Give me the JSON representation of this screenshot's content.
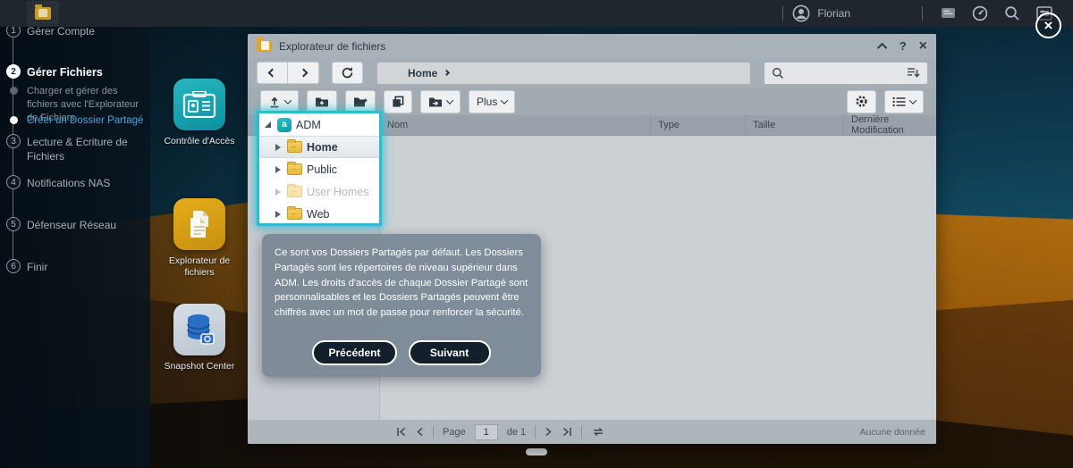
{
  "topbar": {
    "user_name": "Florian",
    "icons": [
      "chat-icon",
      "gauge-icon",
      "search-icon",
      "preferences-icon"
    ]
  },
  "overlay": {
    "close_glyph": "×"
  },
  "sidebar": {
    "steps": [
      {
        "kind": "step",
        "num": "1",
        "label": "Gérer Compte",
        "state": ""
      },
      {
        "kind": "step",
        "num": "2",
        "label": "Gérer Fichiers",
        "state": "active"
      },
      {
        "kind": "sub",
        "label": "Charger et gérer des fichiers avec l'Explorateur de Fichiers",
        "state": ""
      },
      {
        "kind": "sub",
        "label": "Créer un Dossier Partagé",
        "state": "active"
      },
      {
        "kind": "step",
        "num": "3",
        "label": "Lecture & Ecriture de Fichiers",
        "state": ""
      },
      {
        "kind": "step",
        "num": "4",
        "label": "Notifications NAS",
        "state": ""
      },
      {
        "kind": "step",
        "num": "5",
        "label": "Défenseur Réseau",
        "state": ""
      },
      {
        "kind": "step",
        "num": "6",
        "label": "Finir",
        "state": ""
      }
    ]
  },
  "desktop": {
    "icons": [
      {
        "key": "access",
        "label": "Contrôle d'Accès"
      },
      {
        "key": "explorer",
        "label": "Explorateur de fichiers"
      },
      {
        "key": "snapshot",
        "label": "Snapshot Center"
      }
    ]
  },
  "window": {
    "title": "Explorateur de fichiers",
    "breadcrumb": "Home",
    "help_glyph": "?",
    "close_glyph": "×",
    "toolbar": {
      "plus_label": "Plus"
    },
    "columns": [
      "Nom",
      "Type",
      "Taille",
      "Dernière Modification"
    ],
    "adm_icon_letter": "a",
    "tree": [
      {
        "label": "ADM",
        "icon": "adm",
        "level": 0,
        "expanded": true
      },
      {
        "label": "Home",
        "icon": "shared-folder",
        "level": 1,
        "selected": true
      },
      {
        "label": "Public",
        "icon": "shared-folder",
        "level": 1
      },
      {
        "label": "User Homes",
        "icon": "shared-folder",
        "level": 1,
        "disabled": true
      },
      {
        "label": "Web",
        "icon": "shared-folder",
        "level": 1
      }
    ],
    "status": {
      "page_label": "Page",
      "page_value": "1",
      "of_label": "de 1",
      "empty_label": "Aucune donnée"
    }
  },
  "tooltip": {
    "text": "Ce sont vos Dossiers Partagés par défaut. Les Dossiers Partagés sont les répertoires de niveau supérieur dans ADM. Les droits d'accès de chaque Dossier Partagé sont personnalisables et les Dossiers Partagés peuvent être chiffrés avec un mot de passe pour renforcer la sécurité.",
    "prev_label": "Précédent",
    "next_label": "Suivant"
  },
  "colors": {
    "accent": "#2fbccd",
    "active_link": "#38aadf",
    "tile_teal": "#1aa9b4",
    "tile_amber": "#d89c14"
  }
}
